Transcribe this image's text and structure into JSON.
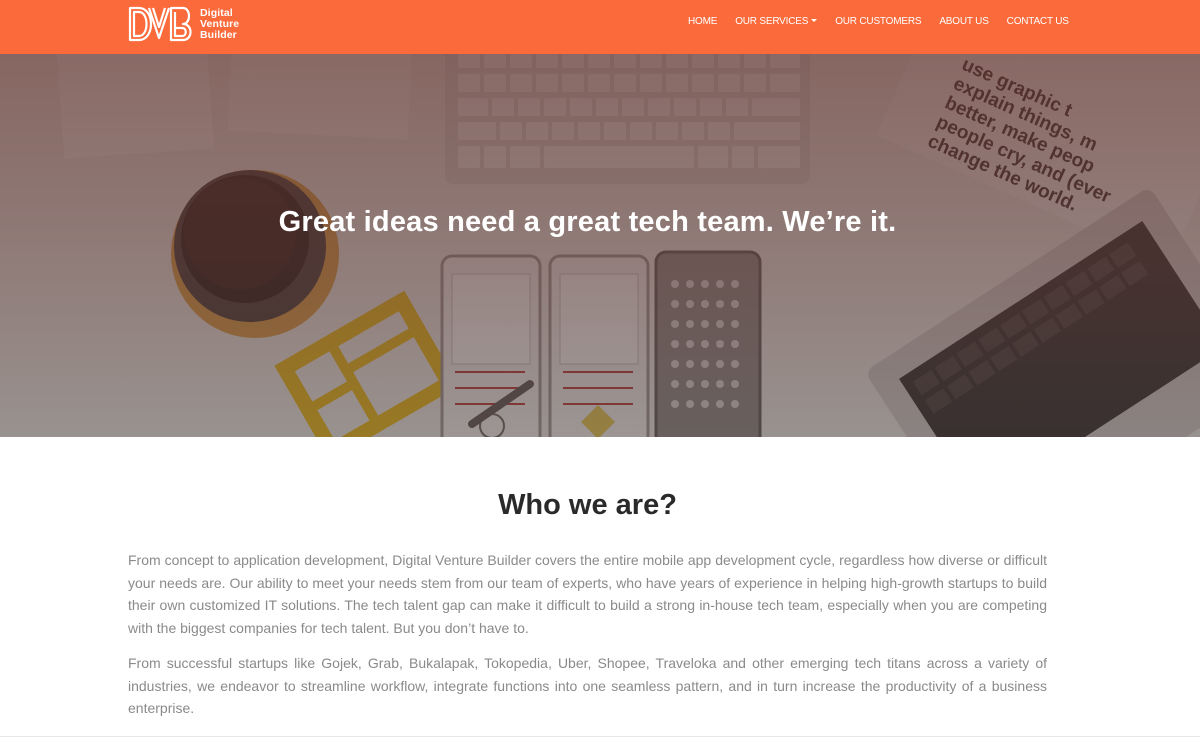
{
  "brand": {
    "mark": "DVB",
    "name_lines": [
      "Digital",
      "Venture",
      "Builder"
    ],
    "color": "#fb6a3a"
  },
  "nav": {
    "items": [
      {
        "label": "HOME"
      },
      {
        "label": "OUR SERVICES",
        "has_dropdown": true
      },
      {
        "label": "OUR CUSTOMERS"
      },
      {
        "label": "ABOUT US"
      },
      {
        "label": "CONTACT US"
      }
    ]
  },
  "hero": {
    "title": "Great ideas need a great tech team. We’re it.",
    "book_text": [
      "use graphic t",
      "explain things, m",
      "better, make peop",
      "people cry, and (ever",
      "change the world."
    ]
  },
  "about": {
    "title": "Who we are?",
    "paragraphs": [
      "From concept to application development, Digital Venture Builder covers the entire mobile app development cycle, regardless how diverse or difficult your needs are. Our ability to meet your needs stem from our team of experts, who have years of experience in helping high-growth startups to build their own customized IT solutions. The tech talent gap can make it difficult to build a strong in-house tech team, especially when you are competing with the biggest companies for tech talent. But you don’t have to.",
      "From successful startups like Gojek, Grab, Bukalapak, Tokopedia, Uber, Shopee, Traveloka and other emerging tech titans across a variety of industries, we endeavor to streamline workflow, integrate functions into one seamless pattern, and in turn increase the productivity of a business enterprise."
    ]
  }
}
